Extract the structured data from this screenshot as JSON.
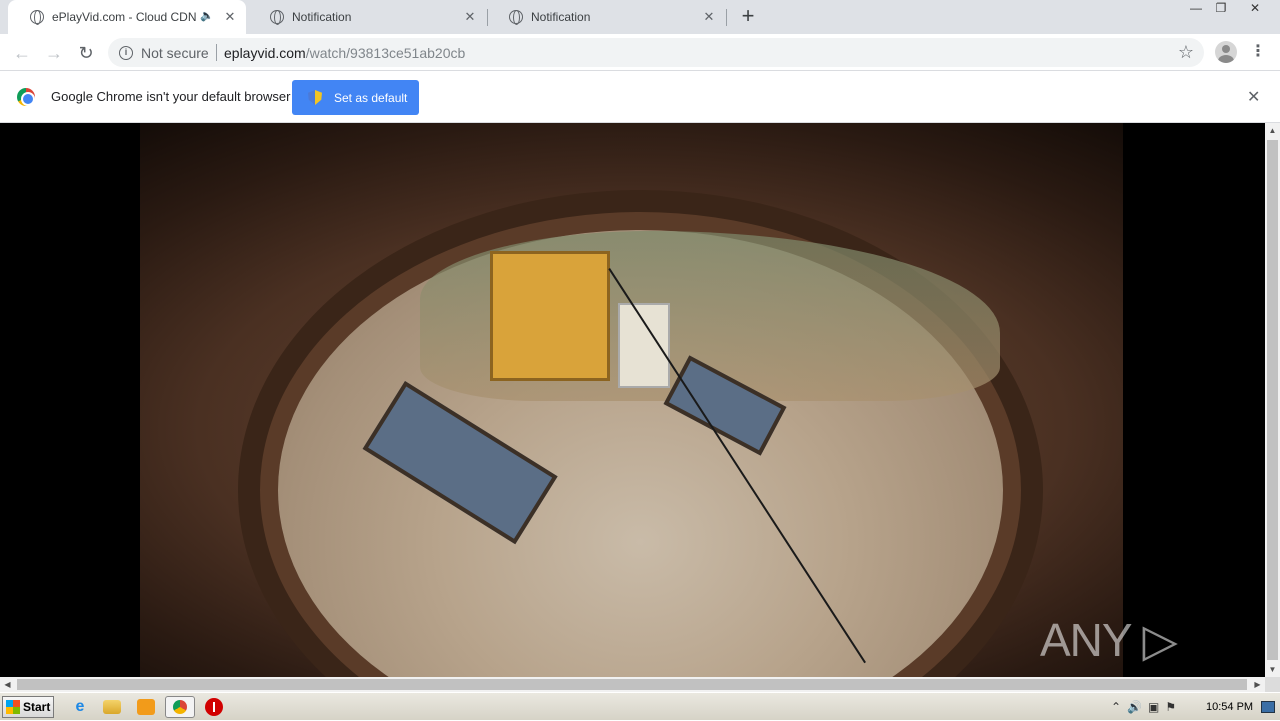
{
  "browser": {
    "tabs": [
      {
        "title": "ePlayVid.com - Cloud CDN",
        "active": true,
        "audio": true
      },
      {
        "title": "Notification",
        "active": false
      },
      {
        "title": "Notification",
        "active": false
      }
    ],
    "new_tab_symbol": "+",
    "window_controls": {
      "minimize": "—",
      "restore": "❐",
      "close": "✕"
    },
    "toolbar": {
      "back_icon": "←",
      "forward_icon": "→",
      "reload_icon": "↻",
      "security_label": "Not secure",
      "url_host": "eplayvid.com",
      "url_path": "/watch/93813ce51ab20cb",
      "bookmark_icon": "☆",
      "menu_icon": "⋮"
    },
    "infobar": {
      "message": "Google Chrome isn't your default browser",
      "button_label": "Set as default",
      "close_icon": "✕"
    }
  },
  "page": {
    "watermark": "ANY ▷ RUN"
  },
  "taskbar": {
    "start_label": "Start",
    "ie_icon": "e",
    "tray_icons": [
      "⌃",
      "🔊",
      "▣",
      "⚑"
    ],
    "clock": "10:54 PM"
  },
  "colors": {
    "tabstrip": "#dee1e6",
    "accent": "#4285f4",
    "video_background": "#000000"
  }
}
